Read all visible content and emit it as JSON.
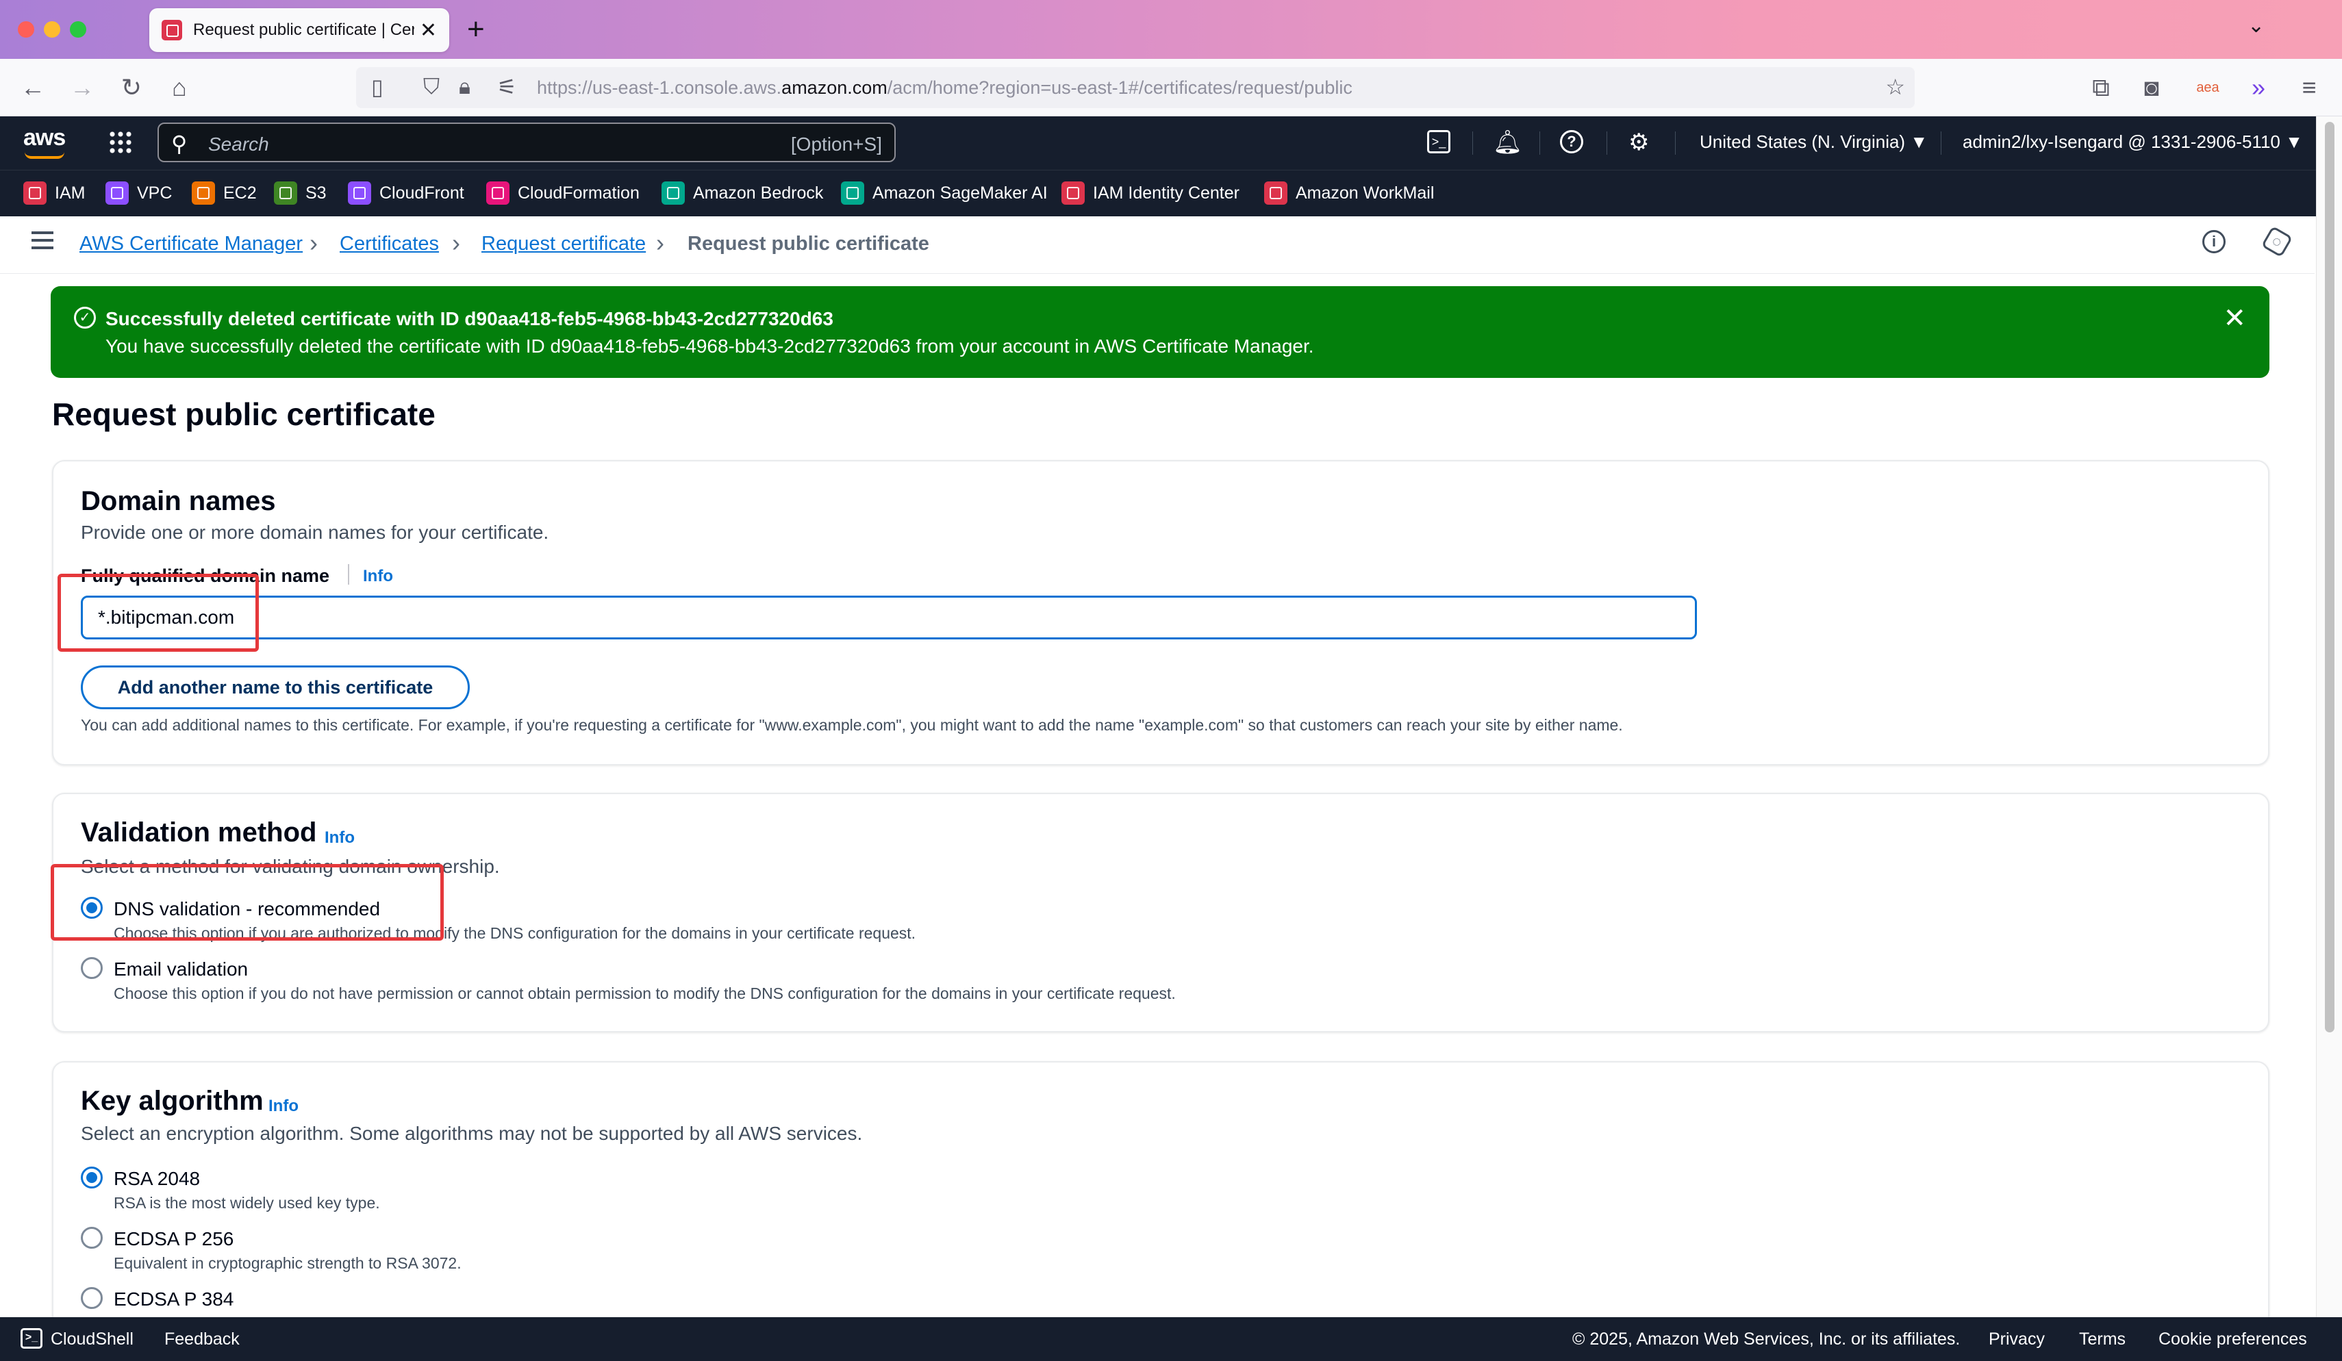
{
  "browser": {
    "tab_title": "Request public certificate | Certi",
    "tab_close": "✕",
    "new_tab": "+",
    "url_prefix": "https://us-east-1.console.aws.",
    "url_domain": "amazon.com",
    "url_suffix": "/acm/home?region=us-east-1#/certificates/request/public"
  },
  "aws_nav": {
    "logo": "aws",
    "search_placeholder": "Search",
    "search_shortcut": "[Option+S]",
    "region": "United States (N. Virginia) ▼",
    "account": "admin2/lxy-Isengard @ 1331-2906-5110 ▼"
  },
  "favorites": [
    {
      "label": "IAM",
      "color": "#dd344c"
    },
    {
      "label": "VPC",
      "color": "#8c4fff"
    },
    {
      "label": "EC2",
      "color": "#ed7100"
    },
    {
      "label": "S3",
      "color": "#3f8624"
    },
    {
      "label": "CloudFront",
      "color": "#8c4fff"
    },
    {
      "label": "CloudFormation",
      "color": "#e7157b"
    },
    {
      "label": "Amazon Bedrock",
      "color": "#01a88d"
    },
    {
      "label": "Amazon SageMaker AI",
      "color": "#01a88d"
    },
    {
      "label": "IAM Identity Center",
      "color": "#dd344c"
    },
    {
      "label": "Amazon WorkMail",
      "color": "#dd344c"
    }
  ],
  "breadcrumb": {
    "items": [
      "AWS Certificate Manager",
      "Certificates",
      "Request certificate"
    ],
    "current": "Request public certificate"
  },
  "flash": {
    "title": "Successfully deleted certificate with ID d90aa418-feb5-4968-bb43-2cd277320d63",
    "body": "You have successfully deleted the certificate with ID d90aa418-feb5-4968-bb43-2cd277320d63 from your account in AWS Certificate Manager."
  },
  "page_title": "Request public certificate",
  "domain_names": {
    "heading": "Domain names",
    "description": "Provide one or more domain names for your certificate.",
    "field_label": "Fully qualified domain name",
    "info": "Info",
    "value": "*.bitipcman.com",
    "add_button": "Add another name to this certificate",
    "hint": "You can add additional names to this certificate. For example, if you're requesting a certificate for \"www.example.com\", you might want to add the name \"example.com\" so that customers can reach your site by either name."
  },
  "validation": {
    "heading": "Validation method",
    "info": "Info",
    "description": "Select a method for validating domain ownership.",
    "options": [
      {
        "label": "DNS validation - recommended",
        "desc": "Choose this option if you are authorized to modify the DNS configuration for the domains in your certificate request.",
        "selected": true
      },
      {
        "label": "Email validation",
        "desc": "Choose this option if you do not have permission or cannot obtain permission to modify the DNS configuration for the domains in your certificate request.",
        "selected": false
      }
    ]
  },
  "key_algorithm": {
    "heading": "Key algorithm",
    "info": "Info",
    "description": "Select an encryption algorithm. Some algorithms may not be supported by all AWS services.",
    "options": [
      {
        "label": "RSA 2048",
        "desc": "RSA is the most widely used key type.",
        "selected": true
      },
      {
        "label": "ECDSA P 256",
        "desc": "Equivalent in cryptographic strength to RSA 3072.",
        "selected": false
      },
      {
        "label": "ECDSA P 384",
        "desc": "",
        "selected": false
      }
    ]
  },
  "footer": {
    "cloudshell": "CloudShell",
    "feedback": "Feedback",
    "copyright": "© 2025, Amazon Web Services, Inc. or its affiliates.",
    "privacy": "Privacy",
    "terms": "Terms",
    "cookies": "Cookie preferences"
  }
}
